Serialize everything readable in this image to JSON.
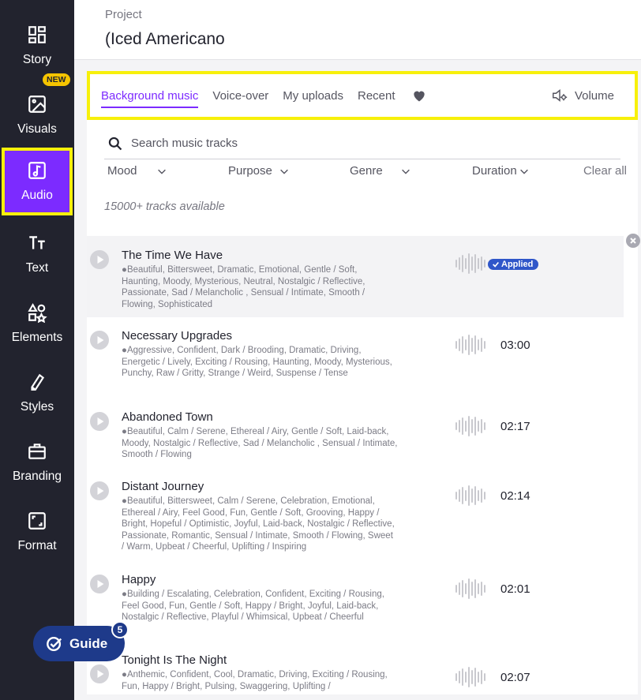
{
  "sidebar": {
    "items": [
      {
        "label": "Story",
        "icon": "dashboard-icon"
      },
      {
        "label": "Visuals",
        "icon": "image-icon",
        "badge": "NEW"
      },
      {
        "label": "Audio",
        "icon": "music-note-icon",
        "active": true
      },
      {
        "label": "Text",
        "icon": "text-icon"
      },
      {
        "label": "Elements",
        "icon": "shapes-icon"
      },
      {
        "label": "Styles",
        "icon": "brush-icon"
      },
      {
        "label": "Branding",
        "icon": "briefcase-icon"
      },
      {
        "label": "Format",
        "icon": "resize-icon"
      }
    ]
  },
  "header": {
    "project_label": "Project",
    "project_name": "(Iced Americano"
  },
  "tabs": {
    "items": [
      "Background music",
      "Voice-over",
      "My uploads",
      "Recent"
    ],
    "volume_label": "Volume"
  },
  "search": {
    "placeholder": "Search music tracks"
  },
  "filters": {
    "mood": "Mood",
    "purpose": "Purpose",
    "genre": "Genre",
    "duration": "Duration",
    "clear_all": "Clear all"
  },
  "count": "15000+ tracks available",
  "tracks": [
    {
      "title": "The Time We Have",
      "tags": "●Beautiful, Bittersweet, Dramatic, Emotional, Gentle / Soft, Haunting, Moody, Mysterious, Neutral, Nostalgic / Reflective, Passionate, Sad / Melancholic , Sensual / Intimate, Smooth / Flowing, Sophisticated",
      "duration": "",
      "applied": "Applied"
    },
    {
      "title": "Necessary Upgrades",
      "tags": "●Aggressive, Confident, Dark / Brooding, Dramatic, Driving, Energetic / Lively, Exciting / Rousing, Haunting, Moody, Mysterious, Punchy, Raw / Gritty, Strange / Weird, Suspense / Tense",
      "duration": "03:00"
    },
    {
      "title": "Abandoned Town",
      "tags": "●Beautiful, Calm / Serene, Ethereal / Airy, Gentle / Soft, Laid-back, Moody, Nostalgic / Reflective, Sad / Melancholic , Sensual / Intimate, Smooth / Flowing",
      "duration": "02:17"
    },
    {
      "title": "Distant Journey",
      "tags": "●Beautiful, Bittersweet, Calm / Serene, Celebration, Emotional, Ethereal / Airy, Feel Good, Fun, Gentle / Soft, Grooving, Happy / Bright, Hopeful / Optimistic, Joyful, Laid-back, Nostalgic / Reflective, Passionate, Romantic, Sensual / Intimate, Smooth / Flowing, Sweet / Warm, Upbeat / Cheerful, Uplifting / Inspiring",
      "duration": "02:14"
    },
    {
      "title": "Happy",
      "tags": "●Building / Escalating, Celebration, Confident, Exciting / Rousing, Feel Good, Fun, Gentle / Soft, Happy / Bright, Joyful, Laid-back, Nostalgic / Reflective, Playful / Whimsical, Upbeat / Cheerful",
      "duration": "02:01"
    },
    {
      "title": "Tonight Is The Night",
      "tags": "●Anthemic, Confident, Cool, Dramatic, Driving, Exciting / Rousing, Fun, Happy / Bright, Pulsing, Swaggering, Uplifting /",
      "duration": "02:07"
    }
  ],
  "guide": {
    "label": "Guide",
    "count": "5"
  },
  "colors": {
    "sidebar_bg": "#22232e",
    "accent": "#7c2bff",
    "highlight": "#f7f00b",
    "applied_badge": "#2f56c9",
    "guide_bg": "#1e3a8a"
  }
}
